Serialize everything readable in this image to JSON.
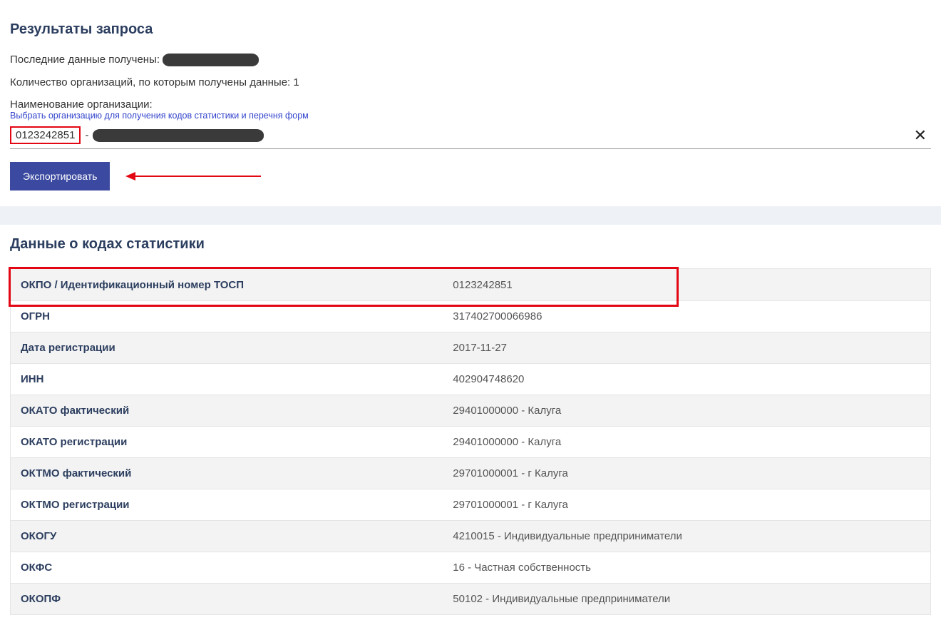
{
  "header": {
    "results_title": "Результаты запроса",
    "last_data_label": "Последние данные получены:",
    "org_count_text": "Количество организаций, по которым получены данные: 1",
    "org_name_label": "Наименование организации:",
    "select_org_link": "Выбрать организацию для получения кодов статистики и перечня форм"
  },
  "org_input": {
    "code": "0123242851",
    "separator": "-"
  },
  "buttons": {
    "export_label": "Экспортировать"
  },
  "codes_section": {
    "title": "Данные о кодах статистики"
  },
  "codes": [
    {
      "label": "ОКПО / Идентификационный номер ТОСП",
      "value": "0123242851"
    },
    {
      "label": "ОГРН",
      "value": "317402700066986"
    },
    {
      "label": "Дата регистрации",
      "value": "2017-11-27"
    },
    {
      "label": "ИНН",
      "value": "402904748620"
    },
    {
      "label": "ОКАТО фактический",
      "value": "29401000000 - Калуга"
    },
    {
      "label": "ОКАТО регистрации",
      "value": "29401000000 - Калуга"
    },
    {
      "label": "ОКТМО фактический",
      "value": "29701000001 - г Калуга"
    },
    {
      "label": "ОКТМО регистрации",
      "value": "29701000001 - г Калуга"
    },
    {
      "label": "ОКОГУ",
      "value": "4210015 - Индивидуальные предприниматели"
    },
    {
      "label": "ОКФС",
      "value": "16 - Частная собственность"
    },
    {
      "label": "ОКОПФ",
      "value": "50102 - Индивидуальные предприниматели"
    }
  ]
}
